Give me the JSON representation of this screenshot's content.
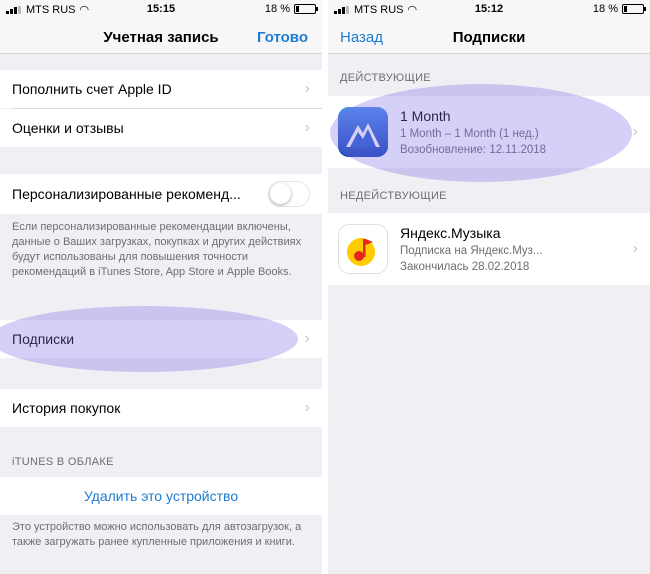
{
  "left_screen": {
    "status": {
      "carrier": "MTS RUS",
      "time": "15:15",
      "battery": "18 %",
      "battery_level": 0.18
    },
    "nav": {
      "title": "Учетная запись",
      "right_button": "Готово"
    },
    "rows": {
      "top_up": "Пополнить счет Apple ID",
      "ratings": "Оценки и отзывы",
      "personalized": "Персонализированные рекоменд...",
      "personalized_enabled": false,
      "personalized_note": "Если персонализированные рекомендации включены, данные о Ваших загрузках, покупках и других действиях будут использованы для повышения точности рекомендаций в iTunes Store, App Store и Apple Books.",
      "subscriptions": "Подписки",
      "purchase_history": "История покупок"
    },
    "itunes_cloud": {
      "header": "iTUNES В ОБЛАКЕ",
      "remove_device": "Удалить это устройство",
      "note": "Это устройство можно использовать для автозагрузок, а также загружать ранее купленные приложения и книги."
    }
  },
  "right_screen": {
    "status": {
      "carrier": "MTS RUS",
      "time": "15:12",
      "battery": "18 %",
      "battery_level": 0.18
    },
    "nav": {
      "back_button": "Назад",
      "title": "Подписки"
    },
    "active": {
      "header": "ДЕЙСТВУЮЩИЕ",
      "title": "1 Month",
      "detail": "1 Month – 1 Month (1 нед.)",
      "renewal": "Возобновление: 12.11.2018"
    },
    "inactive": {
      "header": "НЕДЕЙСТВУЮЩИЕ",
      "title": "Яндекс.Музыка",
      "detail": "Подписка на Яндекс.Муз...",
      "ended": "Закончилась 28.02.2018"
    }
  },
  "colors": {
    "accent": "#1e7bd2",
    "highlight": "#786ee6",
    "background": "#efeff4"
  },
  "icons": {
    "chevron": "›",
    "wifi": "wifi-icon",
    "signal": "signal-icon",
    "battery": "battery-icon"
  }
}
